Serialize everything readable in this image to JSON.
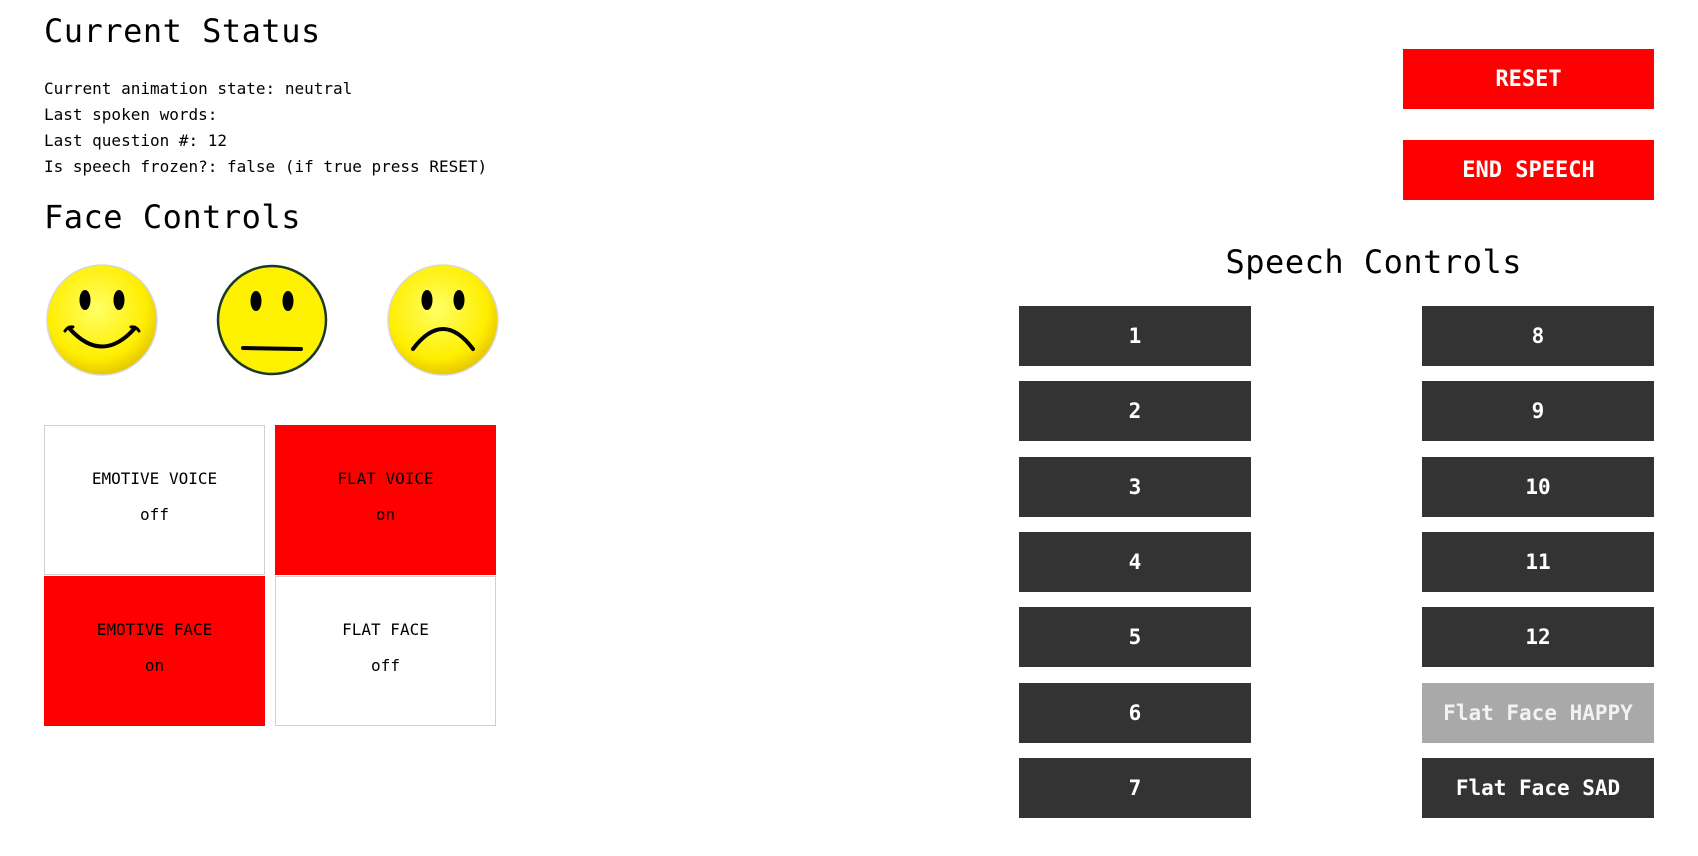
{
  "status": {
    "title": "Current Status",
    "lines": [
      "Current animation state: neutral",
      "Last spoken words:",
      "Last question #: 12",
      "Is speech frozen?: false (if true press RESET)"
    ]
  },
  "face_controls": {
    "title": "Face Controls",
    "faces": [
      "happy-face",
      "neutral-face",
      "sad-face"
    ],
    "toggles": {
      "emotive_voice": {
        "label": "EMOTIVE VOICE",
        "state": "off"
      },
      "flat_voice": {
        "label": "FLAT VOICE",
        "state": "on"
      },
      "emotive_face": {
        "label": "EMOTIVE FACE",
        "state": "on"
      },
      "flat_face": {
        "label": "FLAT FACE",
        "state": "off"
      }
    }
  },
  "actions": {
    "reset_label": "RESET",
    "end_speech_label": "END SPEECH"
  },
  "speech": {
    "title": "Speech Controls",
    "left_column": [
      "1",
      "2",
      "3",
      "4",
      "5",
      "6",
      "7"
    ],
    "right_column": [
      "8",
      "9",
      "10",
      "11",
      "12",
      "Flat Face HAPPY",
      "Flat Face SAD"
    ],
    "disabled_button": "Flat Face HAPPY"
  },
  "colors": {
    "accent_red": "#ff0000",
    "button_dark": "#333333",
    "button_disabled": "#a9a9a9",
    "face_yellow": "#ffee00"
  }
}
